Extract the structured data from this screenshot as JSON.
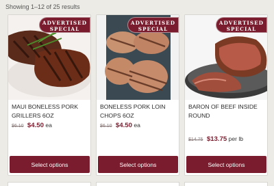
{
  "results": {
    "text": "Showing 1–12 of 25 results"
  },
  "badge": {
    "line1": "ADVERTISED",
    "line2": "SPECIAL"
  },
  "products": [
    {
      "title": "MAUI BONELESS PORK GRILLERS 6oz",
      "old_price": "$6.10",
      "new_price": "$4.50",
      "unit": "ea",
      "button": "Select options"
    },
    {
      "title": "BONELESS PORK LOIN CHOPS 6oz",
      "old_price": "$6.10",
      "new_price": "$4.50",
      "unit": "ea",
      "button": "Select options"
    },
    {
      "title": "BARON OF BEEF INSIDE ROUND",
      "old_price": "$14.75",
      "new_price": "$13.75",
      "unit": "per lb",
      "button": "Select options"
    }
  ],
  "colors": {
    "accent": "#7b1c2e",
    "background": "#ecebe6"
  }
}
